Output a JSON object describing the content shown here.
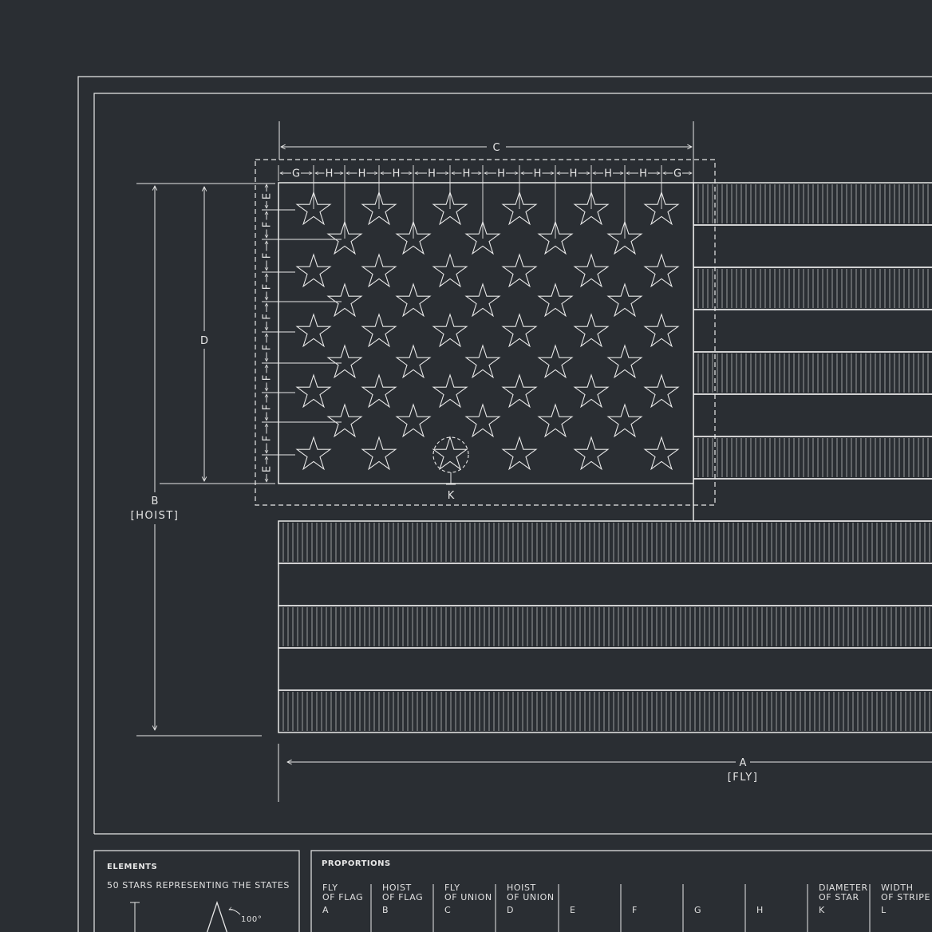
{
  "dimension_labels": {
    "fly_letter": "A",
    "fly_caption": "[FLY]",
    "hoist_letter": "B",
    "hoist_caption": "[HOIST]",
    "union_width": "C",
    "union_height": "D",
    "edge_vertical": "E",
    "star_row_spacing": "F",
    "edge_horizontal": "G",
    "star_col_spacing": "H",
    "star_diameter": "K"
  },
  "elements_panel": {
    "title": "ELEMENTS",
    "description": "50 STARS REPRESENTING THE STATES",
    "angle_label": "100°"
  },
  "proportions_panel": {
    "title": "PROPORTIONS",
    "columns": [
      {
        "line1": "FLY",
        "line2": "OF FLAG",
        "letter": "A"
      },
      {
        "line1": "HOIST",
        "line2": "OF FLAG",
        "letter": "B"
      },
      {
        "line1": "FLY",
        "line2": "OF UNION",
        "letter": "C"
      },
      {
        "line1": "HOIST",
        "line2": "OF UNION",
        "letter": "D"
      },
      {
        "line1": "",
        "line2": "",
        "letter": "E"
      },
      {
        "line1": "",
        "line2": "",
        "letter": "F"
      },
      {
        "line1": "",
        "line2": "",
        "letter": "G"
      },
      {
        "line1": "",
        "line2": "",
        "letter": "H"
      },
      {
        "line1": "DIAMETER",
        "line2": "OF STAR",
        "letter": "K"
      },
      {
        "line1": "WIDTH",
        "line2": "OF STRIPE",
        "letter": "L"
      }
    ]
  },
  "colors": {
    "background": "#2a2e33",
    "line": "#e8e8e8"
  },
  "flag": {
    "star_count": 50,
    "stripe_count": 13
  }
}
